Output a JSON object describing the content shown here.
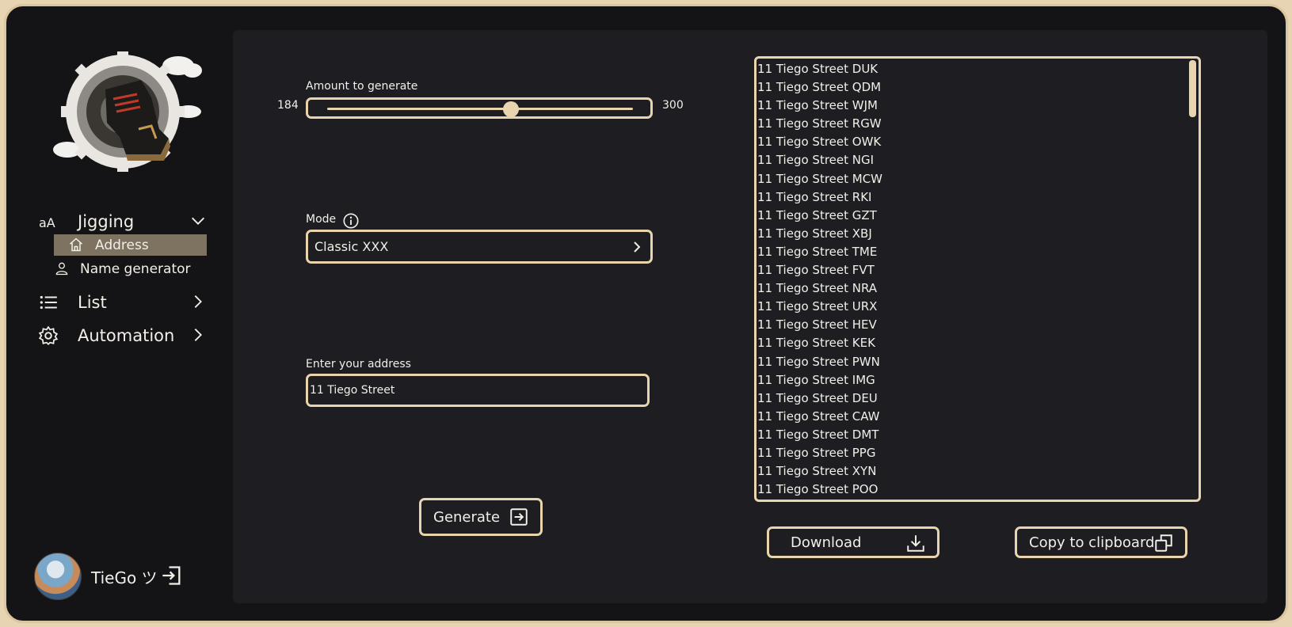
{
  "sidebar": {
    "nav": [
      {
        "label": "Jigging",
        "icon": "font-case-icon",
        "expanded": true
      },
      {
        "label": "List",
        "icon": "list-icon",
        "expanded": false
      },
      {
        "label": "Automation",
        "icon": "gear-icon",
        "expanded": false
      }
    ],
    "sub_items": [
      {
        "label": "Address",
        "icon": "home-icon",
        "active": true
      },
      {
        "label": "Name generator",
        "icon": "user-icon",
        "active": false
      }
    ],
    "user": {
      "name": "TieGo ツ"
    }
  },
  "form": {
    "amount_label": "Amount to generate",
    "amount_min": "184",
    "amount_max": "300",
    "amount_value_fraction": 0.6,
    "mode_label": "Mode",
    "mode_value": "Classic XXX",
    "address_label": "Enter your address",
    "address_value": "11 Tiego Street",
    "generate_label": "Generate"
  },
  "output": {
    "rows": [
      "11 Tiego Street DUK",
      "11 Tiego Street QDM",
      "11 Tiego Street WJM",
      "11 Tiego Street RGW",
      "11 Tiego Street OWK",
      "11 Tiego Street NGI",
      "11 Tiego Street MCW",
      "11 Tiego Street RKI",
      "11 Tiego Street GZT",
      "11 Tiego Street XBJ",
      "11 Tiego Street TME",
      "11 Tiego Street FVT",
      "11 Tiego Street NRA",
      "11 Tiego Street URX",
      "11 Tiego Street HEV",
      "11 Tiego Street KEK",
      "11 Tiego Street PWN",
      "11 Tiego Street IMG",
      "11 Tiego Street DEU",
      "11 Tiego Street CAW",
      "11 Tiego Street DMT",
      "11 Tiego Street PPG",
      "11 Tiego Street XYN",
      "11 Tiego Street POO"
    ],
    "download_label": "Download",
    "copy_label": "Copy to clipboard"
  },
  "colors": {
    "accent": "#e8d4ae",
    "panel": "#1d1d22",
    "background": "#141416",
    "active_item": "#7d7360"
  }
}
